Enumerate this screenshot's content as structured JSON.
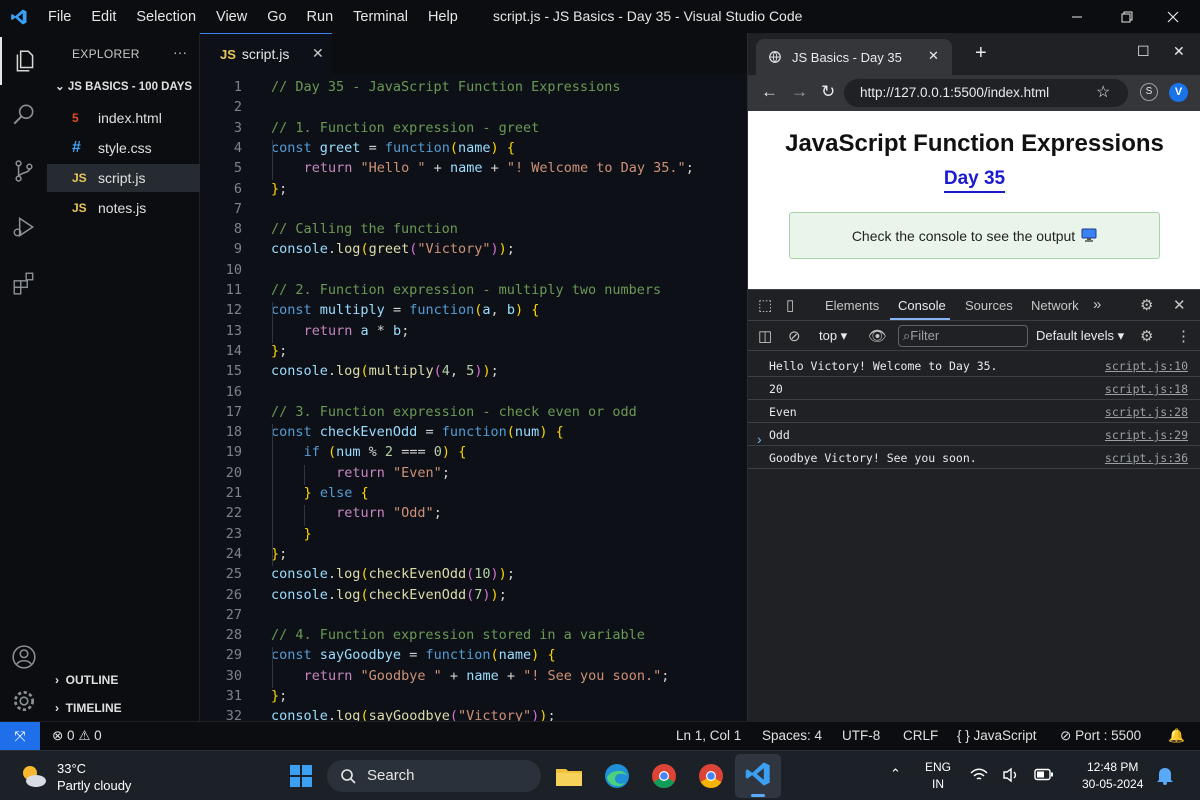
{
  "titlebar": {
    "menu": [
      "File",
      "Edit",
      "Selection",
      "View",
      "Go",
      "Run",
      "Terminal",
      "Help"
    ],
    "title": "script.js - JS Basics - Day 35 - Visual Studio Code"
  },
  "explorer": {
    "title": "EXPLORER",
    "more": "···",
    "folder": "JS BASICS - 100 DAYS",
    "files": [
      {
        "icon": "5",
        "name": "index.html",
        "color": "#e44d26"
      },
      {
        "icon": "#",
        "name": "style.css",
        "color": "#42a5f5"
      },
      {
        "icon": "JS",
        "name": "script.js",
        "color": "#e8c55b"
      },
      {
        "icon": "JS",
        "name": "notes.js",
        "color": "#e8c55b"
      }
    ],
    "outline": "OUTLINE",
    "timeline": "TIMELINE"
  },
  "editor": {
    "tab": {
      "icon": "JS",
      "name": "script.js",
      "close": "✕"
    },
    "lines": [
      "// Day 35 - JavaScript Function Expressions",
      "",
      "// 1. Function expression - greet",
      "const greet = function(name) {",
      "    return \"Hello \" + name + \"! Welcome to Day 35.\";",
      "};",
      "",
      "// Calling the function",
      "console.log(greet(\"Victory\"));",
      "",
      "// 2. Function expression - multiply two numbers",
      "const multiply = function(a, b) {",
      "    return a * b;",
      "};",
      "console.log(multiply(4, 5));",
      "",
      "// 3. Function expression - check even or odd",
      "const checkEvenOdd = function(num) {",
      "    if (num % 2 === 0) {",
      "        return \"Even\";",
      "    } else {",
      "        return \"Odd\";",
      "    }",
      "};",
      "console.log(checkEvenOdd(10));",
      "console.log(checkEvenOdd(7));",
      "",
      "// 4. Function expression stored in a variable",
      "const sayGoodbye = function(name) {",
      "    return \"Goodbye \" + name + \"! See you soon.\";",
      "};",
      "console.log(sayGoodbye(\"Victory\"));"
    ]
  },
  "browser": {
    "tab_title": "JS Basics - Day 35",
    "url": "http://127.0.0.1:5500/index.html",
    "avatar": "V",
    "page": {
      "heading": "JavaScript Function Expressions",
      "subheading": "Day 35",
      "notice": "Check the console to see the output"
    },
    "devtools": {
      "tabs": [
        "Elements",
        "Console",
        "Sources",
        "Network"
      ],
      "context": "top ▾",
      "filter_placeholder": "Filter",
      "levels": "Default levels ▾",
      "logs": [
        {
          "msg": "Hello Victory! Welcome to Day 35.",
          "src": "script.js:10"
        },
        {
          "msg": "20",
          "src": "script.js:18"
        },
        {
          "msg": "Even",
          "src": "script.js:28"
        },
        {
          "msg": "Odd",
          "src": "script.js:29"
        },
        {
          "msg": "Goodbye Victory! See you soon.",
          "src": "script.js:36"
        }
      ]
    }
  },
  "statusbar": {
    "problems": "⊗ 0 ⚠ 0",
    "position": "Ln 1, Col 1",
    "spaces": "Spaces: 4",
    "encoding": "UTF-8",
    "eol": "CRLF",
    "language": "{ } JavaScript",
    "port": "Port : 5500"
  },
  "taskbar": {
    "temp": "33°C",
    "weather": "Partly cloudy",
    "search": "Search",
    "lang_top": "ENG",
    "lang_bottom": "IN",
    "time": "12:48 PM",
    "date": "30-05-2024"
  },
  "colors": {
    "accent": "#1f6feb",
    "selection_tab": "#262b31"
  }
}
